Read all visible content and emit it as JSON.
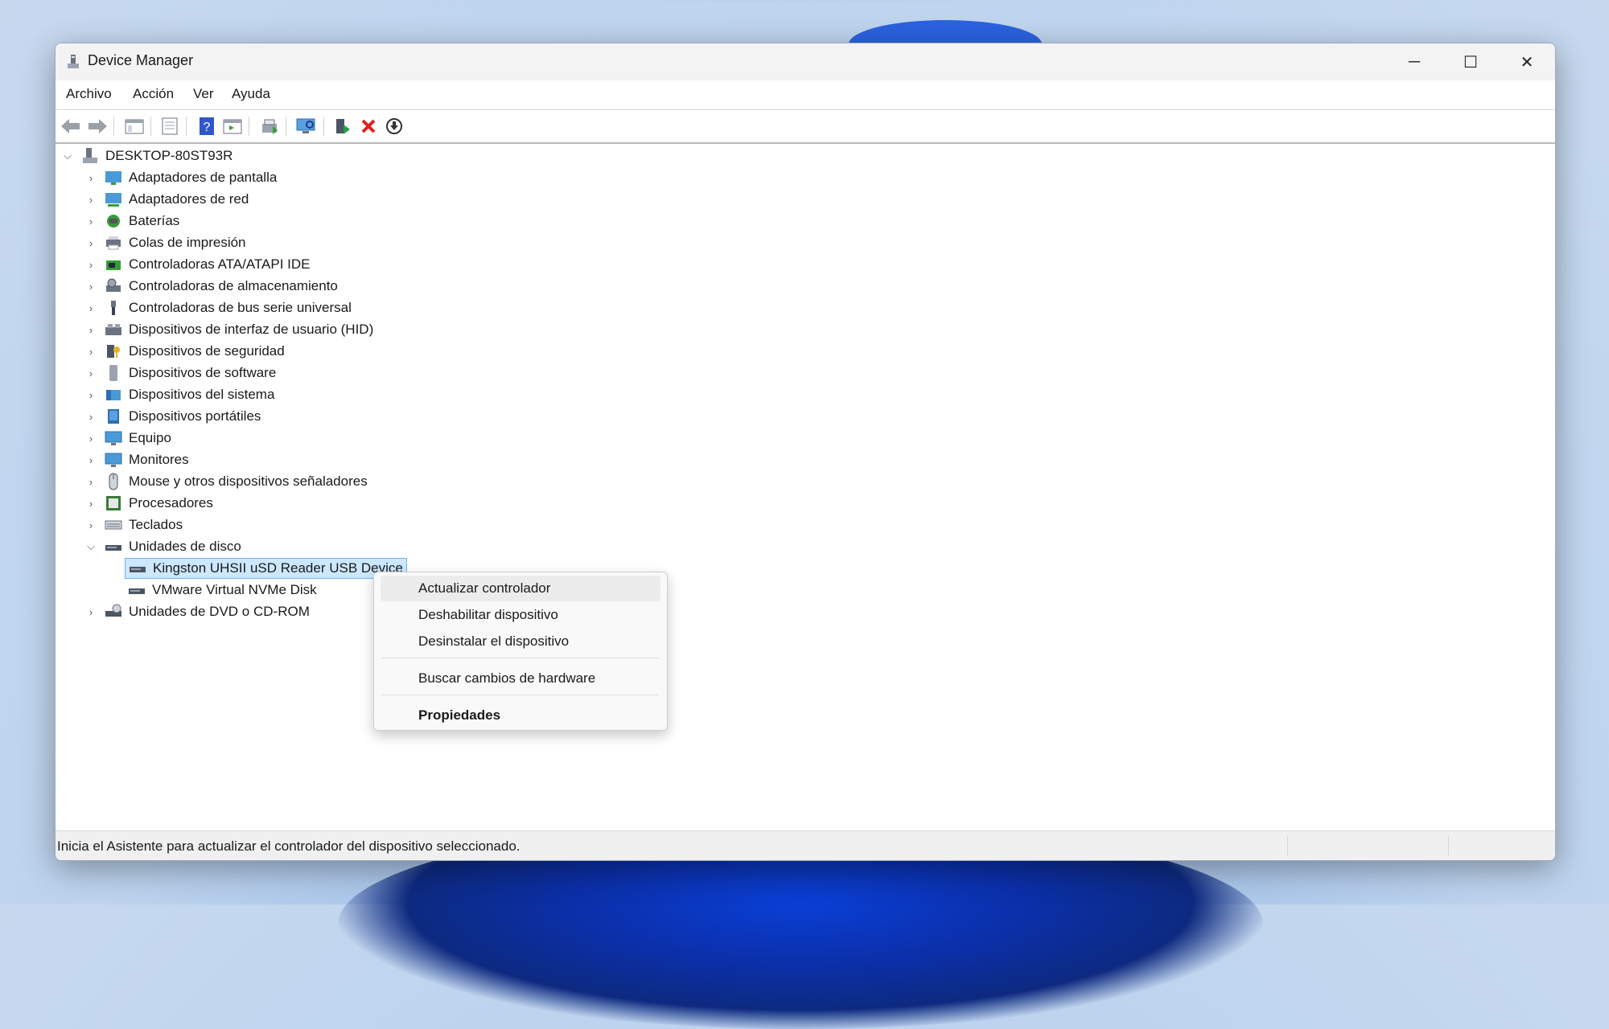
{
  "window": {
    "title": "Device Manager",
    "controls": {
      "minimize": "─",
      "maximize": "☐",
      "close": "✕"
    }
  },
  "menu": [
    "Archivo",
    "Acción",
    "Ver",
    "Ayuda"
  ],
  "toolbar_icons": [
    "back-arrow-icon",
    "forward-arrow-icon",
    "show-hide-tree-icon",
    "properties-icon",
    "help-icon",
    "view-icon",
    "update-driver-icon",
    "scan-hardware-icon",
    "add-driver-icon",
    "uninstall-icon",
    "download-icon"
  ],
  "tree": {
    "root": "DESKTOP-80ST93R",
    "categories": [
      "Adaptadores de pantalla",
      "Adaptadores de red",
      "Baterías",
      "Colas de impresión",
      "Controladoras ATA/ATAPI IDE",
      "Controladoras de almacenamiento",
      "Controladoras de bus serie universal",
      "Dispositivos de interfaz de usuario (HID)",
      "Dispositivos de seguridad",
      "Dispositivos de software",
      "Dispositivos del sistema",
      "Dispositivos portátiles",
      "Equipo",
      "Monitores",
      "Mouse y otros dispositivos señaladores",
      "Procesadores",
      "Teclados"
    ],
    "expanded": "Unidades de disco",
    "children": [
      "Kingston UHSII uSD Reader USB Device",
      "VMware Virtual NVMe Disk"
    ],
    "after": "Unidades de DVD o CD-ROM"
  },
  "context_menu": {
    "update": "Actualizar controlador",
    "disable": "Deshabilitar dispositivo",
    "uninstall": "Desinstalar el dispositivo",
    "scan": "Buscar cambios de hardware",
    "properties": "Propiedades"
  },
  "status": "Inicia el Asistente para actualizar el controlador del dispositivo seleccionado.",
  "colors": {
    "selection": "#cce8ff",
    "selection_border": "#6fb3ea",
    "uninstall_red": "#e02020"
  }
}
